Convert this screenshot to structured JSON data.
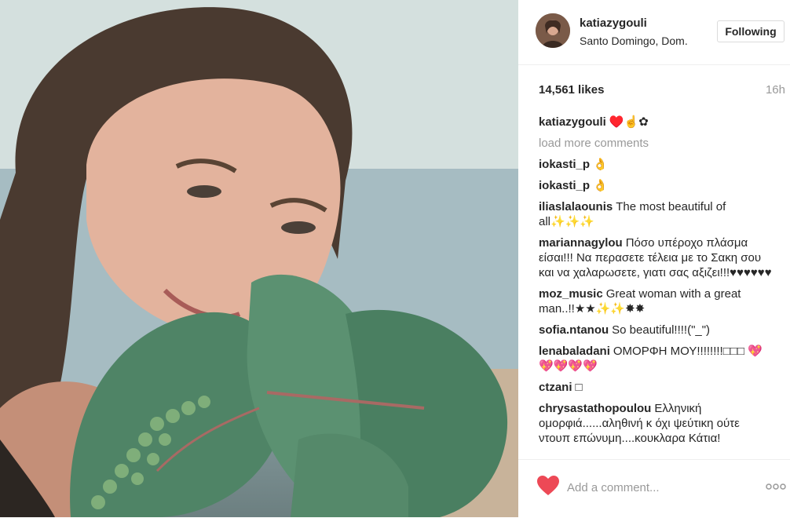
{
  "post": {
    "username": "katiazygouli",
    "location": "Santo Domingo, Dom.",
    "follow_label": "Following",
    "likes": "14,561 likes",
    "time": "16h"
  },
  "caption": {
    "username": "katiazygouli",
    "text": "♥️☝️✿"
  },
  "load_more_label": "load more comments",
  "comments": [
    {
      "username": "iokasti_p",
      "text": "👌"
    },
    {
      "username": "iokasti_p",
      "text": "👌"
    },
    {
      "username": "iliaslalaounis",
      "text": "The most beautiful of all✨✨✨"
    },
    {
      "username": "mariannagylou",
      "text": "Πόσο υπέροχο πλάσμα είσαι!!! Να περασετε τέλεια με το Σακη σου και να χαλαρωσετε, γιατι σας αξιζει!!!♥♥♥♥♥♥"
    },
    {
      "username": "moz_music",
      "text": "Great woman with a great man..!!★★✨✨✸✸"
    },
    {
      "username": "sofia.ntanou",
      "text": "So beautiful!!!!(\"_\")"
    },
    {
      "username": "lenabaladani",
      "text": "ΟΜΟΡΦΗ ΜΟΥ!!!!!!!!□□□ 💖💖💖💖💖"
    },
    {
      "username": "ctzani",
      "text": "□"
    },
    {
      "username": "chrysastathopoulou",
      "text": "Ελληνική ομορφιά......αληθινή κ όχι ψεύτικη ούτε ντουπ επώνυμη....κουκλαρα Κάτια!"
    }
  ],
  "add_comment_placeholder": "Add a comment...",
  "colors": {
    "like_heart": "#ed4956",
    "muted_text": "#999999",
    "border": "#dbdbdb"
  },
  "icons": {
    "like": "heart-icon",
    "more": "more-options-icon"
  }
}
